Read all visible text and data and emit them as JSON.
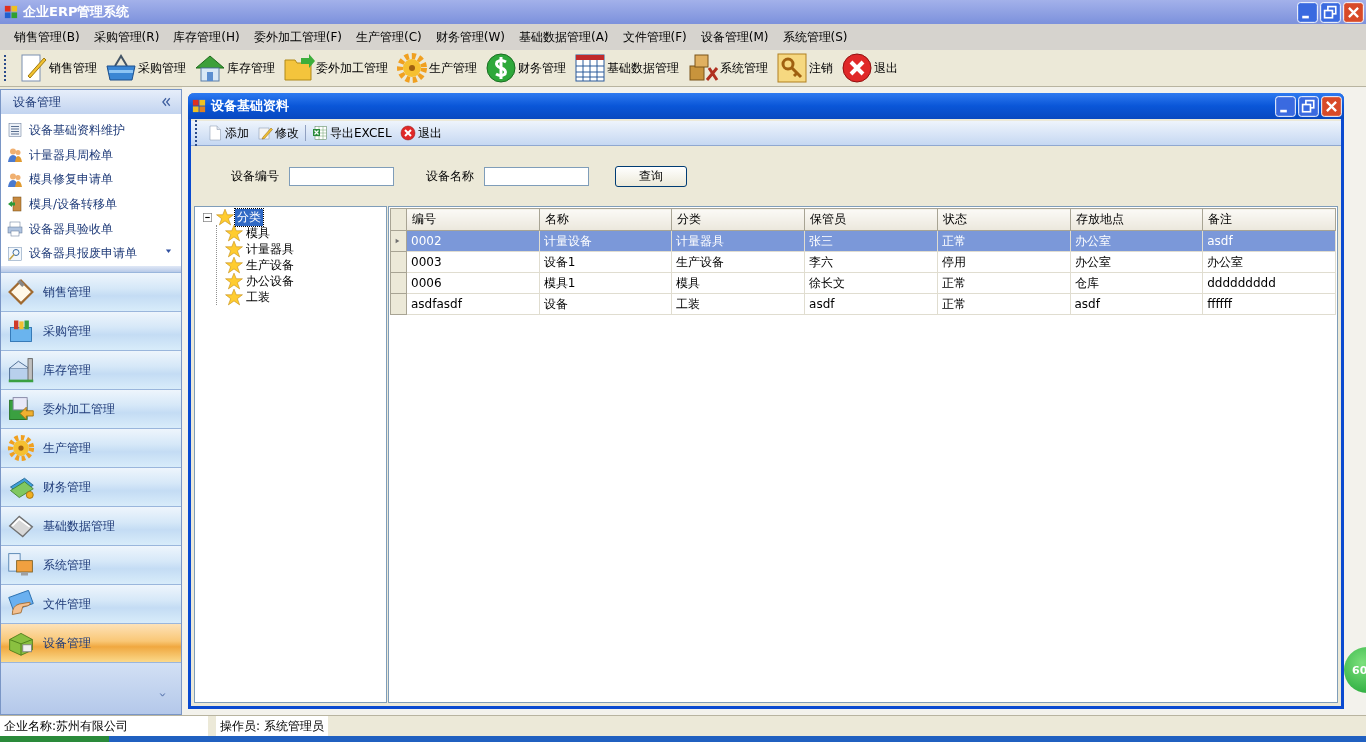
{
  "window": {
    "title": "企业ERP管理系统"
  },
  "menu": [
    "销售管理(B)",
    "采购管理(R)",
    "库存管理(H)",
    "委外加工管理(F)",
    "生产管理(C)",
    "财务管理(W)",
    "基础数据管理(A)",
    "文件管理(F)",
    "设备管理(M)",
    "系统管理(S)"
  ],
  "toolbar": [
    "销售管理",
    "采购管理",
    "库存管理",
    "委外加工管理",
    "生产管理",
    "财务管理",
    "基础数据管理",
    "系统管理",
    "注销",
    "退出"
  ],
  "sidebar": {
    "title": "设备管理",
    "items": [
      "设备基础资料维护",
      "计量器具周检单",
      "模具修复申请单",
      "模具/设备转移单",
      "设备器具验收单",
      "设备器具报废申请单"
    ],
    "nav": [
      {
        "label": "销售管理",
        "selected": false
      },
      {
        "label": "采购管理",
        "selected": false
      },
      {
        "label": "库存管理",
        "selected": false
      },
      {
        "label": "委外加工管理",
        "selected": false
      },
      {
        "label": "生产管理",
        "selected": false
      },
      {
        "label": "财务管理",
        "selected": false
      },
      {
        "label": "基础数据管理",
        "selected": false
      },
      {
        "label": "系统管理",
        "selected": false
      },
      {
        "label": "文件管理",
        "selected": false
      },
      {
        "label": "设备管理",
        "selected": true
      }
    ]
  },
  "child_window": {
    "title": "设备基础资料",
    "toolbar": [
      "添加",
      "修改",
      "导出EXCEL",
      "退出"
    ],
    "search": {
      "fields": [
        {
          "label": "设备编号"
        },
        {
          "label": "设备名称"
        }
      ],
      "button": "查询"
    },
    "tree": {
      "label": "分类",
      "selected": true,
      "expanded": true,
      "children": [
        {
          "label": "模具",
          "selected": false
        },
        {
          "label": "计量器具",
          "selected": false
        },
        {
          "label": "生产设备",
          "selected": false
        },
        {
          "label": "办公设备",
          "selected": false
        },
        {
          "label": "工装",
          "selected": false
        }
      ]
    },
    "table": {
      "columns": [
        "编号",
        "名称",
        "分类",
        "保管员",
        "状态",
        "存放地点",
        "备注"
      ],
      "rows": [
        {
          "cells": [
            "0002",
            "计量设备",
            "计量器具",
            "张三",
            "正常",
            "办公室",
            "asdf"
          ],
          "selected": true
        },
        {
          "cells": [
            "0003",
            "设备1",
            "生产设备",
            "李六",
            "停用",
            "办公室",
            "办公室"
          ],
          "selected": false
        },
        {
          "cells": [
            "0006",
            "模具1",
            "模具",
            "徐长文",
            "正常",
            "仓库",
            "ddddddddd"
          ],
          "selected": false
        },
        {
          "cells": [
            "asdfasdf",
            "设备",
            "工装",
            "asdf",
            "正常",
            "asdf",
            "ffffff"
          ],
          "selected": false
        }
      ]
    }
  },
  "status_bar": {
    "company": "企业名称:苏州有限公司",
    "operator": "操作员: 系统管理员"
  },
  "badge": "60"
}
